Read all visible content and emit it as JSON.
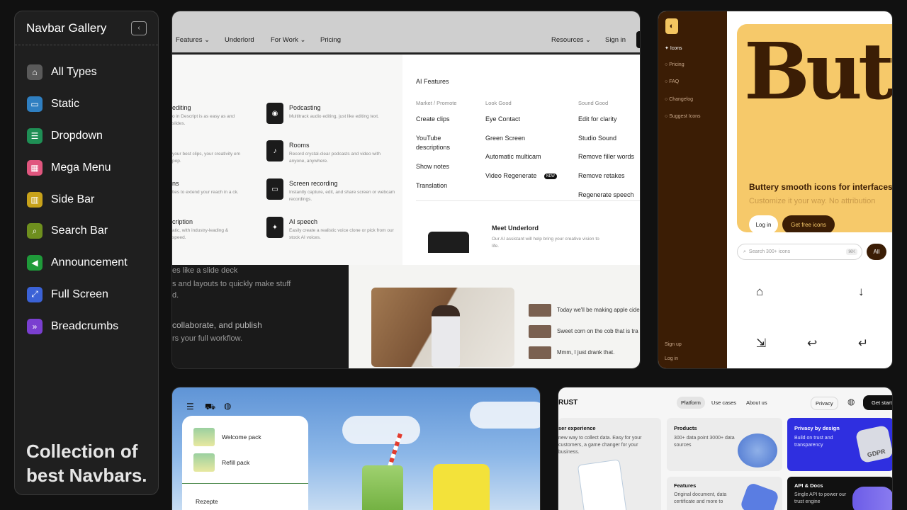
{
  "sidebar": {
    "title": "Navbar Gallery",
    "items": [
      {
        "label": "All Types",
        "icon": "home-icon",
        "color": "#5a5a5a"
      },
      {
        "label": "Static",
        "icon": "browser-window-icon",
        "color": "#2f7fc1"
      },
      {
        "label": "Dropdown",
        "icon": "dropdown-window-icon",
        "color": "#1f8f55"
      },
      {
        "label": "Mega Menu",
        "icon": "grid-menu-icon",
        "color": "#e0567e"
      },
      {
        "label": "Side Bar",
        "icon": "sidebar-columns-icon",
        "color": "#c8a21a"
      },
      {
        "label": "Search Bar",
        "icon": "search-icon",
        "color": "#6e8f1e"
      },
      {
        "label": "Announcement",
        "icon": "megaphone-icon",
        "color": "#1f9a3a"
      },
      {
        "label": "Full Screen",
        "icon": "expand-icon",
        "color": "#3b62d6"
      },
      {
        "label": "Breadcrumbs",
        "icon": "double-chevron-icon",
        "color": "#7a3fd0"
      }
    ],
    "tagline_line1": "Collection of",
    "tagline_line2": "best Navbars."
  },
  "card1": {
    "nav": {
      "features": "Features ⌄",
      "underlord": "Underlord",
      "for_work": "For Work ⌄",
      "pricing": "Pricing",
      "resources": "Resources ⌄",
      "signin": "Sign in"
    },
    "left_items": [
      {
        "title": "editing",
        "desc": "o in Descript is as easy as and slides."
      },
      {
        "title": "",
        "desc": "your best clips, your creativity em pop."
      },
      {
        "title": "ns",
        "desc": "ties to extend your reach in a ck."
      },
      {
        "title": "cription",
        "desc": "atic, with industry-leading & speed."
      }
    ],
    "mid_items": [
      {
        "title": "Podcasting",
        "desc": "Multitrack audio editing, just like editing text."
      },
      {
        "title": "Rooms",
        "desc": "Record crystal-clear podcasts and video with anyone, anywhere."
      },
      {
        "title": "Screen recording",
        "desc": "Instantly capture, edit, and share screen or webcam recordings."
      },
      {
        "title": "AI speech",
        "desc": "Easily create a realistic voice clone or pick from our stock AI voices."
      }
    ],
    "ai_features": "AI Features",
    "col_heads": [
      "Market / Promote",
      "Look Good",
      "Sound Good"
    ],
    "col1": [
      "Create clips",
      "YouTube",
      "descriptions",
      "Show notes",
      "Translation"
    ],
    "col2": [
      "Eye Contact",
      "Green Screen",
      "Automatic multicam",
      "Video Regenerate"
    ],
    "col2_badge": "NEW",
    "col3": [
      "Edit for clarity",
      "Studio Sound",
      "Remove filler words",
      "Remove retakes",
      "Regenerate speech"
    ],
    "underlord_title": "Meet Underlord",
    "underlord_desc": "Our AI assistant will help bring your creative vision to life.",
    "dark_lines": [
      "es like a slide deck",
      "s and layouts to quickly make stuff",
      "d.",
      "collaborate, and publish",
      "rs your full workflow."
    ],
    "transcript": [
      "Today we'll be making apple cide",
      "Sweet corn on the cob that is tra",
      "Mmm, I just drank that."
    ]
  },
  "card2": {
    "nav": [
      "Icons",
      "Pricing",
      "FAQ",
      "Changelog",
      "Suggest Icons"
    ],
    "bottom": [
      "Sign up",
      "Log in"
    ],
    "hero_word": "Butt",
    "headline": "Buttery smooth icons for interfaces",
    "sub": "Customize it your way. No attribution",
    "login": "Log in",
    "get_icons": "Get free icons",
    "search_placeholder": "Search 300+ icons",
    "shortcut": "⌘K",
    "all": "All"
  },
  "card3": {
    "menu_items": [
      "Welcome pack",
      "Refill pack"
    ],
    "section": "Rezepte"
  },
  "card4": {
    "logo": "RUST",
    "pills": [
      "Platform",
      "Use cases",
      "About us"
    ],
    "privacy": "Privacy",
    "get_started": "Get start",
    "tiles": [
      {
        "title": "ser experience",
        "desc": "new way to collect data. Easy for your customers, a game changer for your business."
      },
      {
        "title": "Products",
        "desc": "300+ data point 3000+ data sources"
      },
      {
        "title": "Privacy by design",
        "desc": "Build on trust and transparency"
      },
      {
        "title": "Features",
        "desc": "Original document, data certificate and more to"
      },
      {
        "title": "API & Docs",
        "desc": "Single API to power our trust engine"
      }
    ],
    "gdpr": "GDPR"
  }
}
